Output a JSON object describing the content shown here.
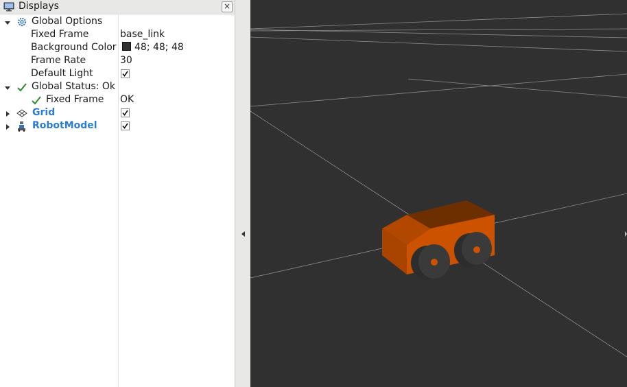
{
  "panel": {
    "title": "Displays",
    "close_glyph": "×",
    "rows": [
      {
        "label": "Global Options",
        "value": ""
      },
      {
        "label": "Fixed Frame",
        "value": "base_link"
      },
      {
        "label": "Background Color",
        "value": "48; 48; 48"
      },
      {
        "label": "Frame Rate",
        "value": "30"
      },
      {
        "label": "Default Light",
        "value": ""
      },
      {
        "label": "Global Status: Ok",
        "value": ""
      },
      {
        "label": "Fixed Frame",
        "value": "OK"
      },
      {
        "label": "Grid",
        "value": ""
      },
      {
        "label": "RobotModel",
        "value": ""
      }
    ]
  },
  "colors": {
    "background": "#303030",
    "display_name": "#2d7dd2",
    "status_ok": "#2e8b2e",
    "robot_body": "#cc5200"
  },
  "icons": {
    "panel": "monitor-icon",
    "global_options": "gear-icon",
    "status": "check-icon",
    "grid": "grid-icon",
    "robot": "robot-icon"
  },
  "states": {
    "default_light": true,
    "grid_enabled": true,
    "robot_model_enabled": true,
    "global_options_expanded": true,
    "global_status_expanded": true,
    "grid_expanded": false,
    "robot_model_expanded": false
  }
}
